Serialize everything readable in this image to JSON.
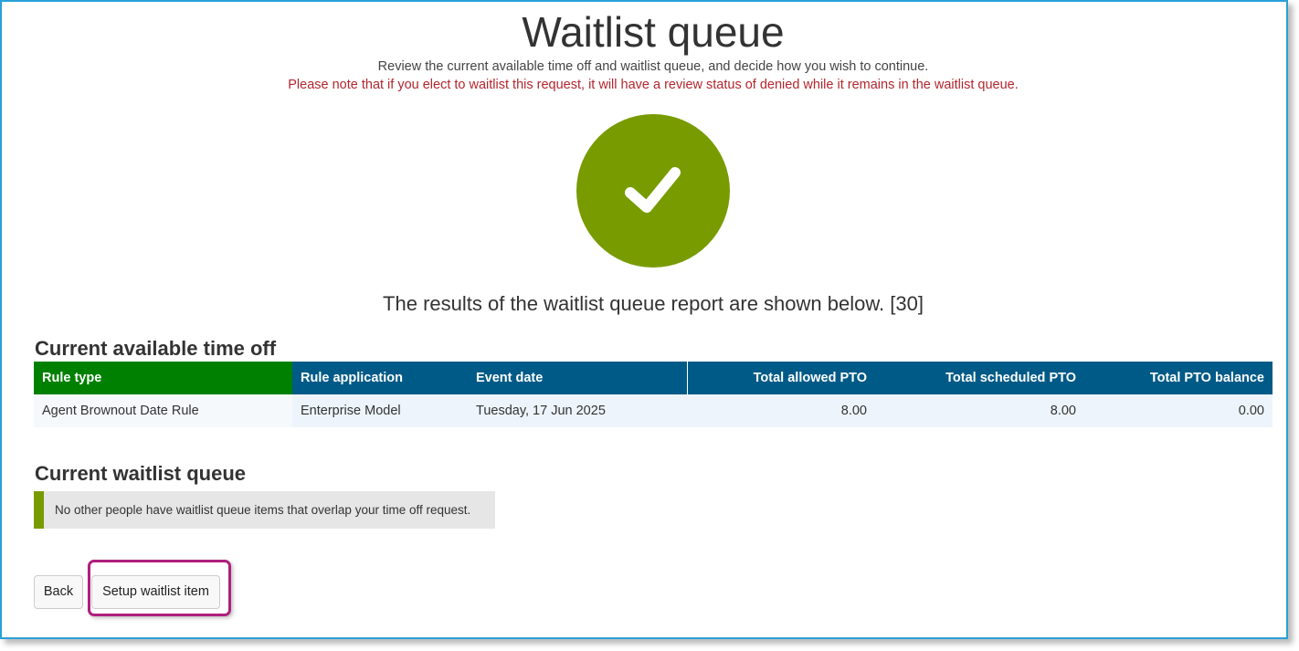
{
  "header": {
    "title": "Waitlist queue",
    "subtitle": "Review the current available time off and waitlist queue, and decide how you wish to continue.",
    "warning": "Please note that if you elect to waitlist this request, it will have a review status of denied while it remains in the waitlist queue."
  },
  "status": {
    "icon": "checkmark-icon",
    "color": "#789b00",
    "results_text": "The results of the waitlist queue report are shown below. [30]"
  },
  "available": {
    "heading": "Current available time off",
    "columns": [
      "Rule type",
      "Rule application",
      "Event date",
      "Total allowed PTO",
      "Total scheduled PTO",
      "Total PTO balance"
    ],
    "rows": [
      [
        "Agent Brownout Date Rule",
        "Enterprise Model",
        "Tuesday, 17 Jun 2025",
        "8.00",
        "8.00",
        "0.00"
      ]
    ]
  },
  "waitlist": {
    "heading": "Current waitlist queue",
    "message": "No other people have waitlist queue items that overlap your time off request."
  },
  "actions": {
    "back_label": "Back",
    "setup_label": "Setup waitlist item"
  },
  "colors": {
    "accent_green": "#789b00",
    "header_blue": "#005a87",
    "header_green": "#008000",
    "warning_red": "#b3262d",
    "highlight_magenta": "#b01f7e"
  }
}
